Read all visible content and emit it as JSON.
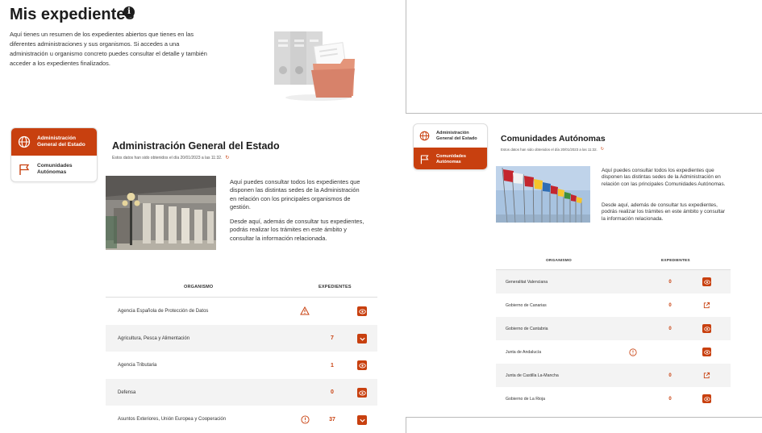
{
  "header": {
    "title": "Mis expedientes",
    "info_glyph": "i",
    "intro": "Aquí tienes un resumen de los expedientes abiertos que tienes en las diferentes administraciones y sus organismos. Si accedes a una administración u organismo concreto puedes consultar el detalle y también acceder a los expedientes finalizados."
  },
  "tabs": {
    "age": "Administración General del Estado",
    "ccaa": "Comunidades Autónomas"
  },
  "left": {
    "title": "Administración General del Estado",
    "subtitle": "Estos datos han sido obtenidos el día 20/01/2023 a las 11:32.",
    "desc1": "Aquí puedes consultar todos los expedientes que disponen las distintas sedes de la Administración en relación con los principales organismos de gestión.",
    "desc2": "Desde aquí, además de consultar tus expedientes, podrás realizar los trámites en este ámbito y consultar la información relacionada.",
    "col_org": "ORGANISMO",
    "col_exp": "EXPEDIENTES",
    "rows": [
      {
        "org": "Agencia Española de Protección de Datos",
        "count": "",
        "status": "warning",
        "action": "eye"
      },
      {
        "org": "Agricultura, Pesca y Alimentación",
        "count": "7",
        "status": "",
        "action": "chevron"
      },
      {
        "org": "Agencia Tributaria",
        "count": "1",
        "status": "",
        "action": "eye"
      },
      {
        "org": "Defensa",
        "count": "0",
        "status": "",
        "action": "eye"
      },
      {
        "org": "Asuntos Exteriores, Unión Europea y Cooperación",
        "count": "37",
        "status": "alert",
        "action": "chevron"
      }
    ]
  },
  "right": {
    "title": "Comunidades Autónomas",
    "subtitle": "Estos datos han sido obtenidos el día 20/01/2023 a las 11:32.",
    "desc1": "Aquí puedes consultar todos los expedientes que disponen las distintas sedes de la Administración en relación con las principales Comunidades Autónomas.",
    "desc2": "Desde aquí, además de consultar tus expedientes, podrás realizar los trámites en este ámbito y consultar la información relacionada.",
    "col_org": "ORGANISMO",
    "col_exp": "EXPEDIENTES",
    "rows": [
      {
        "org": "Generalitat Valenciana",
        "count": "0",
        "status": "",
        "action": "eye"
      },
      {
        "org": "Gobierno de Canarias",
        "count": "0",
        "status": "",
        "action": "external"
      },
      {
        "org": "Gobierno de Cantabria",
        "count": "0",
        "status": "",
        "action": "eye"
      },
      {
        "org": "Junta de Andalucía",
        "count": "",
        "status": "alert",
        "action": "eye"
      },
      {
        "org": "Junta de Castilla La-Mancha",
        "count": "0",
        "status": "",
        "action": "external"
      },
      {
        "org": "Gobierno de La Rioja",
        "count": "0",
        "status": "",
        "action": "eye"
      }
    ]
  },
  "colors": {
    "accent": "#c8400f",
    "row_shade": "#f3f3f3"
  }
}
